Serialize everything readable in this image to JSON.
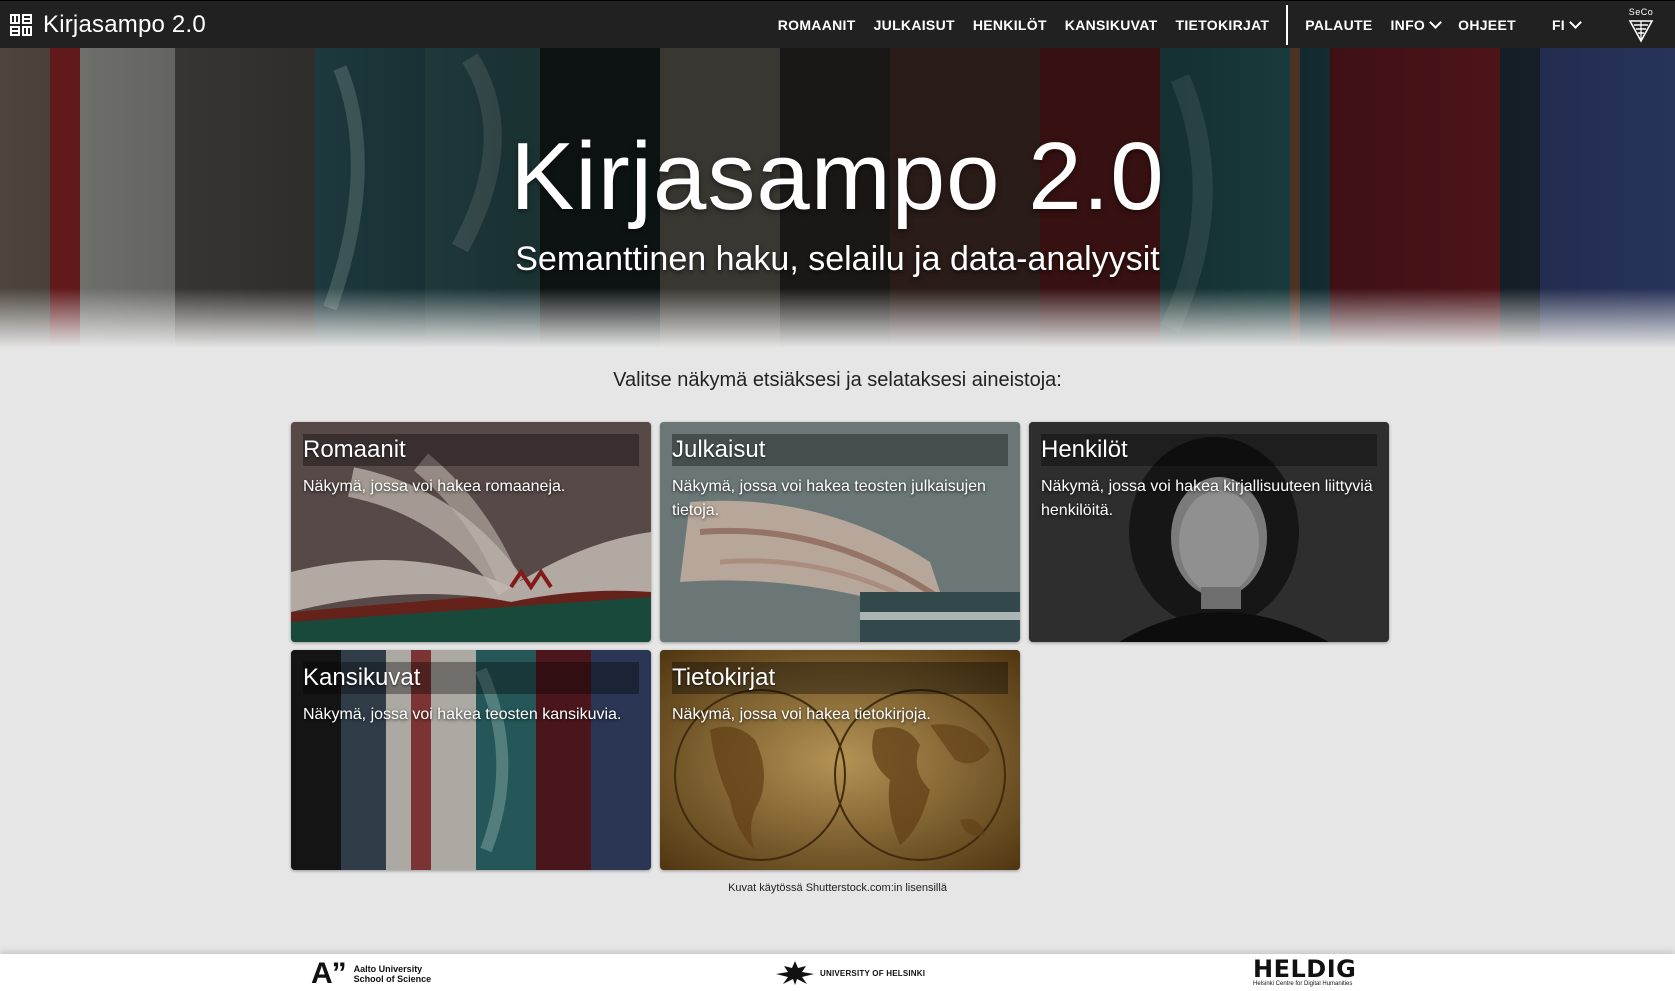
{
  "appbar": {
    "title": "Kirjasampo 2.0",
    "logo_icon": "kirjasampo-logo-icon",
    "nav": [
      {
        "label": "ROMAANIT",
        "name": "nav-romaanit"
      },
      {
        "label": "JULKAISUT",
        "name": "nav-julkaisut"
      },
      {
        "label": "HENKILÖT",
        "name": "nav-henkilot"
      },
      {
        "label": "KANSIKUVAT",
        "name": "nav-kansikuvat"
      },
      {
        "label": "TIETOKIRJAT",
        "name": "nav-tietokirjat"
      }
    ],
    "palaute": "PALAUTE",
    "info": "INFO",
    "ohjeet": "OHJEET",
    "language": "FI",
    "seco_label": "SeCo"
  },
  "hero": {
    "title": "Kirjasampo 2.0",
    "subtitle": "Semanttinen haku, selailu ja data-analyysit"
  },
  "main": {
    "intro": "Valitse näkymä etsiäksesi ja selataksesi aineistoja:",
    "cards": [
      {
        "title": "Romaanit",
        "desc": "Näkymä, jossa voi hakea romaaneja."
      },
      {
        "title": "Julkaisut",
        "desc": "Näkymä, jossa voi hakea teosten julkaisujen tietoja."
      },
      {
        "title": "Henkilöt",
        "desc": "Näkymä, jossa voi hakea kirjallisuuteen liittyviä henkilöitä."
      },
      {
        "title": "Kansikuvat",
        "desc": "Näkymä, jossa voi hakea teosten kansikuvia."
      },
      {
        "title": "Tietokirjat",
        "desc": "Näkymä, jossa voi hakea tietokirjoja."
      }
    ],
    "credit": "Kuvat käytössä Shutterstock.com:in lisensillä"
  },
  "footer": {
    "aalto_mark": "A”",
    "aalto_line1": "Aalto University",
    "aalto_line2": "School of Science",
    "uh": "UNIVERSITY OF HELSINKI",
    "heldig": "HELDIG",
    "heldig_sub": "Helsinki Centre for Digital Humanities"
  },
  "colors": {
    "appbar": "#212121",
    "page_bg": "#e6e6e6",
    "text_light": "#ffffff"
  }
}
